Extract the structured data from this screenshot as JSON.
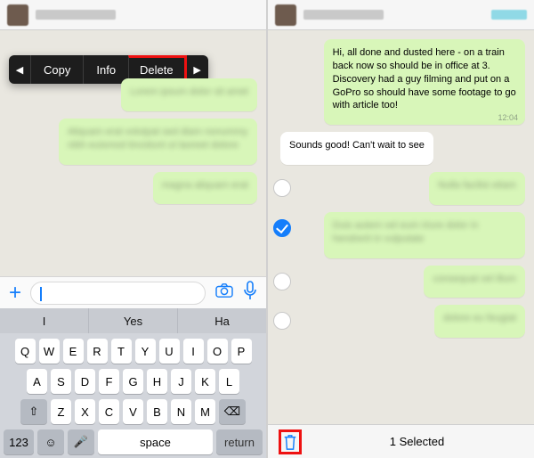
{
  "left": {
    "context_menu": {
      "prev": "◀",
      "copy": "Copy",
      "info": "Info",
      "delete": "Delete",
      "next": "▶"
    },
    "bubbles": [
      {
        "dir": "out",
        "text": "Lorem ipsum dolor sit amet",
        "ts": ""
      },
      {
        "dir": "out",
        "text": "Aliquam erat volutpat sed diam nonummy nibh euismod tincidunt ut laoreet dolore",
        "ts": ""
      },
      {
        "dir": "out",
        "text": "magna aliquam erat",
        "ts": ""
      }
    ],
    "inputbar": {
      "plus": "+"
    },
    "suggestions": [
      "I",
      "Yes",
      "Ha"
    ],
    "keyboard": {
      "rows": [
        [
          "Q",
          "W",
          "E",
          "R",
          "T",
          "Y",
          "U",
          "I",
          "O",
          "P"
        ],
        [
          "A",
          "S",
          "D",
          "F",
          "G",
          "H",
          "J",
          "K",
          "L"
        ],
        [
          "⇧",
          "Z",
          "X",
          "C",
          "V",
          "B",
          "N",
          "M",
          "⌫"
        ]
      ],
      "bottom": {
        "num": "123",
        "emoji": "☺",
        "mic": "🎤",
        "space": "space",
        "ret": "return"
      }
    }
  },
  "right": {
    "bubbles": [
      {
        "dir": "out",
        "sel": null,
        "text": "Hi, all done and dusted here - on a train back now so should be in office at 3. Discovery had a guy filming and put on a GoPro so should have some footage to go with article too!",
        "ts": "12:04"
      },
      {
        "dir": "in",
        "sel": null,
        "text": "Sounds good! Can't wait to see",
        "ts": ""
      },
      {
        "dir": "out",
        "sel": false,
        "text": "Nulla facilisi etiam",
        "ts": ""
      },
      {
        "dir": "out",
        "sel": true,
        "text": "Duis autem vel eum iriure dolor in hendrerit in vulputate",
        "ts": ""
      },
      {
        "dir": "out",
        "sel": false,
        "text": "consequat vel illum",
        "ts": ""
      },
      {
        "dir": "out",
        "sel": false,
        "text": "dolore eu feugiat",
        "ts": ""
      }
    ],
    "footer": {
      "selected": "1 Selected"
    }
  }
}
